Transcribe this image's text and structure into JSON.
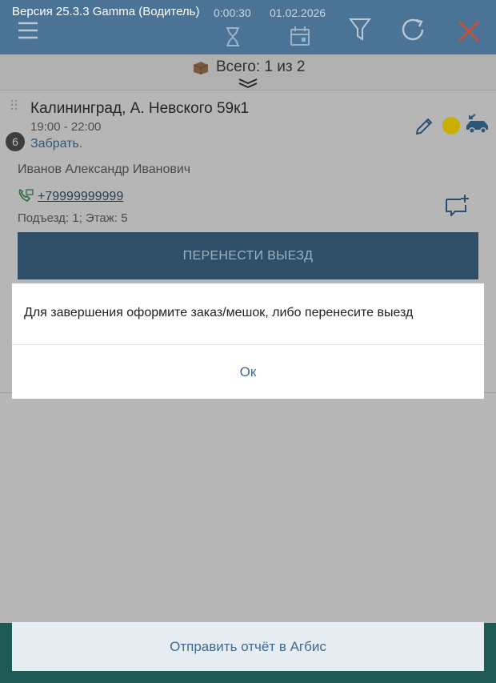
{
  "header": {
    "version": "Версия 25.3.3 Gamma (Водитель)",
    "timer": "0:00:30",
    "date": "01.02.2026",
    "icons": [
      "menu-icon",
      "hourglass-icon",
      "calendar-icon",
      "filter-icon",
      "refresh-icon",
      "close-icon"
    ]
  },
  "summary": {
    "text": "Всего: 1 из 2"
  },
  "order": {
    "badge": "6",
    "address": "Калининград, А. Невского 59к1",
    "time_range": "19:00 - 22:00",
    "action": "Забрать.",
    "customer": "Иванов Александр Иванович",
    "phone": "+79999999999",
    "entrance": "Подъезд: 1; Этаж: 5",
    "move_button": "ПЕРЕНЕСТИ ВЫЕЗД",
    "status_color": "#e6c800"
  },
  "dialog": {
    "message": "Для завершения оформите заказ/мешок, либо перенесите выезд",
    "ok": "Ок"
  },
  "footer": {
    "report_button": "Отправить отчёт в Агбис"
  },
  "colors": {
    "header": "#4a7396",
    "accent": "#3e6b93",
    "footer": "#1f5a55"
  }
}
